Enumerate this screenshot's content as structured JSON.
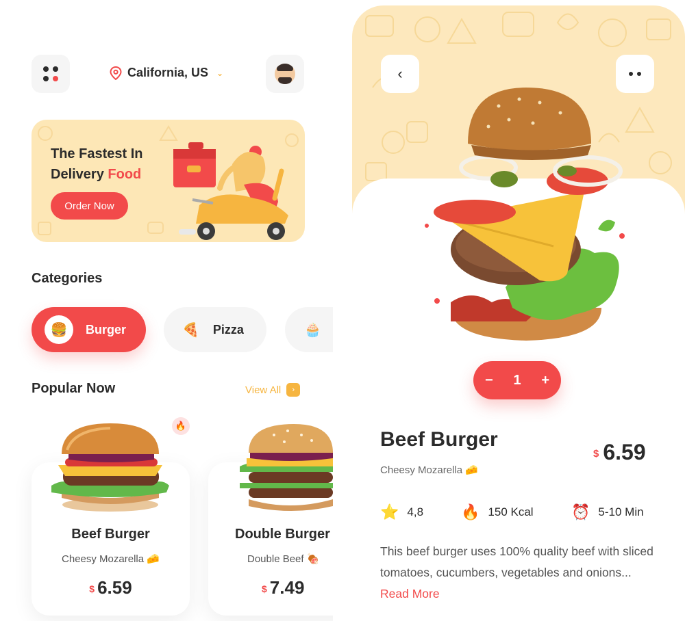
{
  "left_screen": {
    "header": {
      "location": "California, US",
      "menu_icon": "menu-dots-icon",
      "pin_icon": "location-pin-icon",
      "chevron_icon": "chevron-down-icon",
      "avatar_icon": "user-avatar-icon"
    },
    "promo": {
      "title_line1": "The Fastest In",
      "title_line2_plain": "Delivery ",
      "title_line2_accent": "Food",
      "cta": "Order Now"
    },
    "categories": {
      "title": "Categories",
      "items": [
        {
          "label": "Burger",
          "icon": "burger-icon",
          "selected": true
        },
        {
          "label": "Pizza",
          "icon": "pizza-icon",
          "selected": false
        },
        {
          "label": "",
          "icon": "cupcake-icon",
          "selected": false
        }
      ]
    },
    "popular": {
      "title": "Popular Now",
      "view_all": "View All",
      "items": [
        {
          "name": "Beef Burger",
          "subtitle": "Cheesy Mozarella",
          "sub_emoji": "🧀",
          "currency": "$",
          "price": "6.59",
          "badge": "🔥"
        },
        {
          "name": "Double Burger",
          "subtitle": "Double Beef",
          "sub_emoji": "🍖",
          "currency": "$",
          "price": "7.49"
        }
      ]
    }
  },
  "right_screen": {
    "quantity": "1",
    "minus": "−",
    "plus": "+",
    "product": {
      "name": "Beef Burger",
      "subtitle": "Cheesy Mozarella",
      "sub_emoji": "🧀",
      "currency": "$",
      "price": "6.59"
    },
    "stats": {
      "rating": "4,8",
      "calories": "150 Kcal",
      "time": "5-10 Min"
    },
    "description": "This beef burger uses 100% quality beef with sliced tomatoes, cucumbers, vegetables and onions... ",
    "read_more": "Read More"
  },
  "colors": {
    "accent_red": "#f24a4a",
    "accent_yellow": "#f6b540",
    "promo_bg": "#fde7b6"
  }
}
